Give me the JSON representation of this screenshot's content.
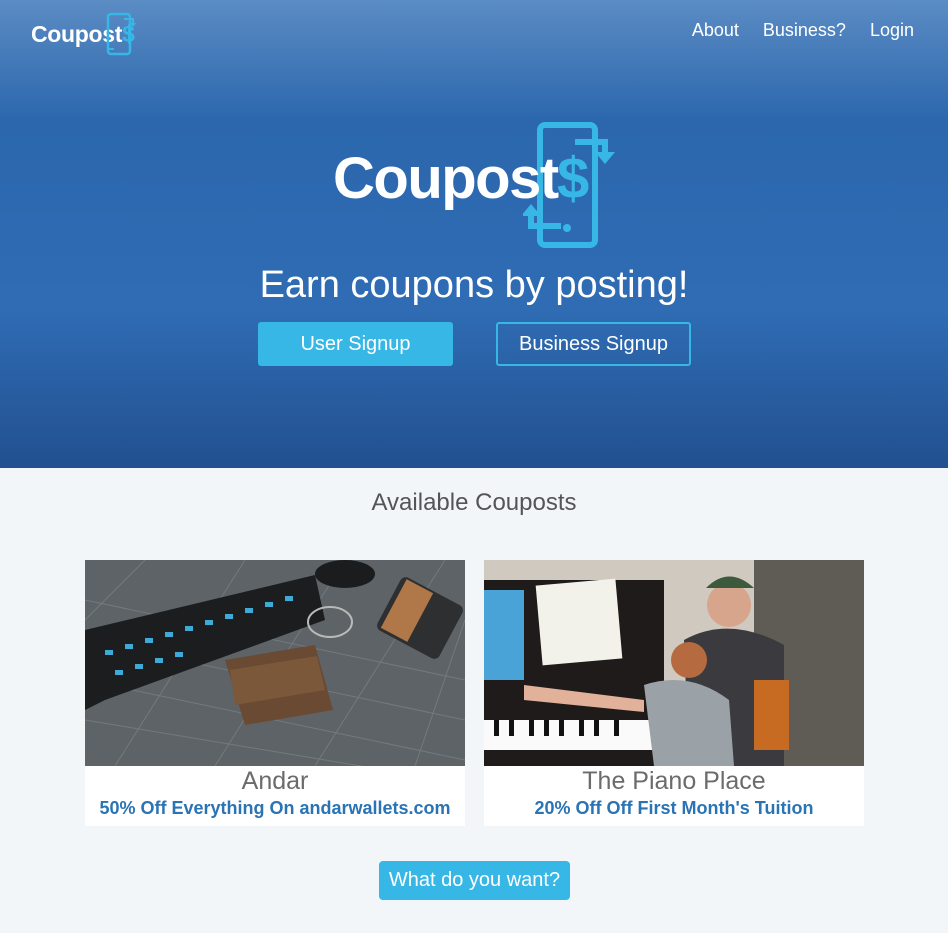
{
  "nav": {
    "logo_text": "Coupost",
    "logo_dollar": "$",
    "links": [
      "About",
      "Business?",
      "Login"
    ]
  },
  "hero": {
    "logo_text": "Coupost",
    "logo_dollar": "$",
    "tagline": "Earn coupons by posting!",
    "user_signup_label": "User Signup",
    "business_signup_label": "Business Signup"
  },
  "available": {
    "title": "Available Couposts",
    "cards": [
      {
        "name": "Andar",
        "offer": "50% Off Everything On andarwallets.com"
      },
      {
        "name": "The Piano Place",
        "offer": "20% Off Off First Month's Tuition"
      }
    ]
  },
  "cta": {
    "label": "What do you want?"
  },
  "colors": {
    "accent": "#37b7e6",
    "hero_blue": "#2f6cb4",
    "offer_blue": "#2a73b4",
    "page_bg": "#f3f6f9"
  },
  "icons": [
    "phone-exchange-icon"
  ]
}
